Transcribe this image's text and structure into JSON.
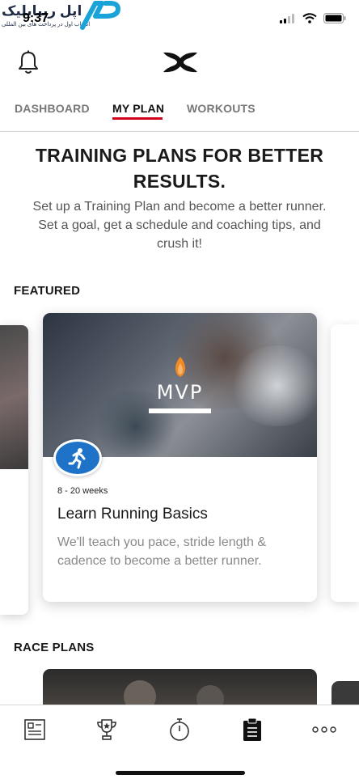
{
  "status_bar": {
    "time": "9:37",
    "watermark_text": "اپل ریپابلیک",
    "watermark_subtext": "انتخاب اول در پرداخت های بین المللی"
  },
  "header": {
    "notification_icon": "bell-icon",
    "brand_icon": "under-armour-logo"
  },
  "tabs": [
    {
      "label": "DASHBOARD",
      "active": false
    },
    {
      "label": "MY PLAN",
      "active": true
    },
    {
      "label": "WORKOUTS",
      "active": false
    }
  ],
  "hero": {
    "title": "TRAINING PLANS FOR BETTER RESULTS.",
    "description": "Set up a Training Plan and become a better runner. Set a goal, get a schedule and coaching tips, and crush it!"
  },
  "featured": {
    "section_label": "FEATURED",
    "card": {
      "logo_text": "MVP",
      "badge_icon": "runner-icon",
      "duration": "8 - 20 weeks",
      "title": "Learn Running Basics",
      "description": "We'll teach you pace, stride length & cadence to become a better runner."
    }
  },
  "race_plans": {
    "section_label": "RACE PLANS"
  },
  "bottom_nav": {
    "items": [
      {
        "icon": "feed-icon",
        "active": false
      },
      {
        "icon": "trophy-icon",
        "active": false
      },
      {
        "icon": "stopwatch-icon",
        "active": false
      },
      {
        "icon": "clipboard-icon",
        "active": true
      },
      {
        "icon": "more-icon",
        "active": false
      }
    ]
  },
  "colors": {
    "accent": "#d0021b",
    "badge_blue": "#1e72c8",
    "mvp_orange": "#f08a24"
  }
}
